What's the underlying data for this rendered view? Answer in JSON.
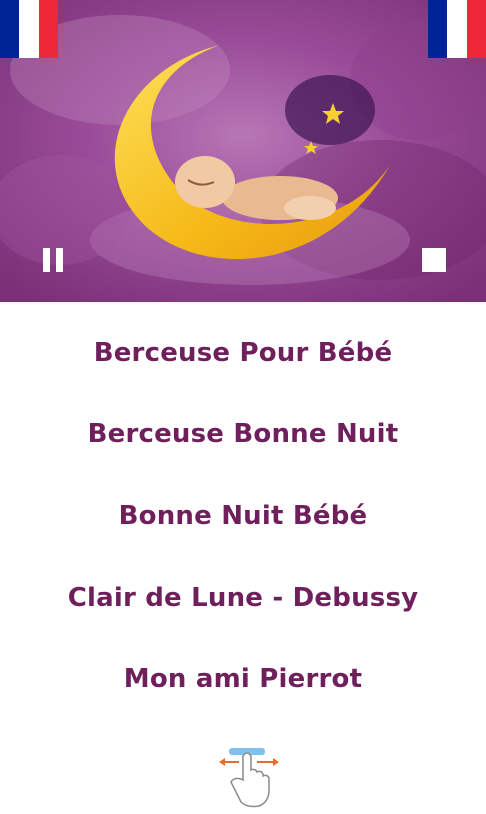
{
  "colors": {
    "accent": "#6e1f5c",
    "flag_blue": "#002395",
    "flag_white": "#ffffff",
    "flag_red": "#ed2939",
    "background_purple": "#8a3c86",
    "moon_yellow": "#f7c21a"
  },
  "header": {
    "image": "baby-sleeping-on-moon",
    "left_flag": "french-flag",
    "right_flag": "french-flag",
    "pause_icon": "pause-icon",
    "stop_icon": "stop-icon"
  },
  "songs": [
    {
      "label": "Berceuse Pour Bébé"
    },
    {
      "label": "Berceuse Bonne Nuit"
    },
    {
      "label": "Bonne Nuit Bébé"
    },
    {
      "label": "Clair de Lune - Debussy"
    },
    {
      "label": "Mon ami Pierrot"
    }
  ],
  "footer": {
    "hint_icon": "swipe-gesture-icon"
  }
}
